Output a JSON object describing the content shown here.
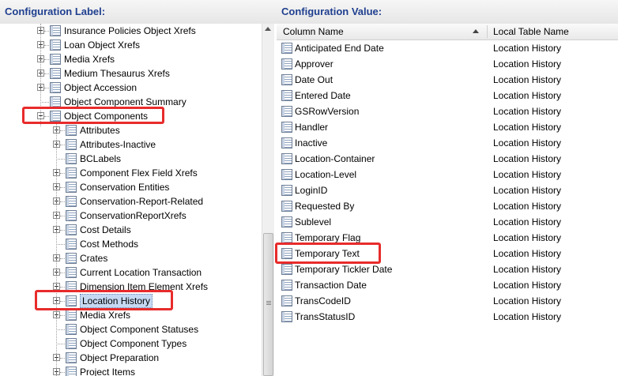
{
  "left_panel": {
    "title": "Configuration Label:"
  },
  "right_panel": {
    "title": "Configuration Value:"
  },
  "tree": [
    {
      "label": "Insurance Policies Object Xrefs",
      "level": 1,
      "expander": "plus"
    },
    {
      "label": "Loan Object Xrefs",
      "level": 1,
      "expander": "plus"
    },
    {
      "label": "Media Xrefs",
      "level": 1,
      "expander": "plus"
    },
    {
      "label": "Medium Thesaurus Xrefs",
      "level": 1,
      "expander": "plus"
    },
    {
      "label": "Object Accession",
      "level": 1,
      "expander": "plus"
    },
    {
      "label": "Object Component Summary",
      "level": 1,
      "expander": "none"
    },
    {
      "label": "Object Components",
      "level": 1,
      "expander": "minus"
    },
    {
      "label": "Attributes",
      "level": 2,
      "expander": "plus"
    },
    {
      "label": "Attributes-Inactive",
      "level": 2,
      "expander": "plus"
    },
    {
      "label": "BCLabels",
      "level": 2,
      "expander": "none"
    },
    {
      "label": "Component Flex Field Xrefs",
      "level": 2,
      "expander": "plus"
    },
    {
      "label": "Conservation Entities",
      "level": 2,
      "expander": "plus"
    },
    {
      "label": "Conservation-Report-Related",
      "level": 2,
      "expander": "plus"
    },
    {
      "label": "ConservationReportXrefs",
      "level": 2,
      "expander": "plus"
    },
    {
      "label": "Cost Details",
      "level": 2,
      "expander": "plus"
    },
    {
      "label": "Cost Methods",
      "level": 2,
      "expander": "none"
    },
    {
      "label": "Crates",
      "level": 2,
      "expander": "plus"
    },
    {
      "label": "Current Location Transaction",
      "level": 2,
      "expander": "plus"
    },
    {
      "label": "Dimension Item Element Xrefs",
      "level": 2,
      "expander": "plus"
    },
    {
      "label": "Location History",
      "level": 2,
      "expander": "plus",
      "selected": true
    },
    {
      "label": "Media Xrefs",
      "level": 2,
      "expander": "plus"
    },
    {
      "label": "Object Component Statuses",
      "level": 2,
      "expander": "none"
    },
    {
      "label": "Object Component Types",
      "level": 2,
      "expander": "none"
    },
    {
      "label": "Object Preparation",
      "level": 2,
      "expander": "plus"
    },
    {
      "label": "Project Items",
      "level": 2,
      "expander": "plus"
    }
  ],
  "grid": {
    "columns": [
      "Column Name",
      "Local Table Name"
    ],
    "rows": [
      [
        "Anticipated End Date",
        "Location History"
      ],
      [
        "Approver",
        "Location History"
      ],
      [
        "Date Out",
        "Location History"
      ],
      [
        "Entered Date",
        "Location History"
      ],
      [
        "GSRowVersion",
        "Location History"
      ],
      [
        "Handler",
        "Location History"
      ],
      [
        "Inactive",
        "Location History"
      ],
      [
        "Location-Container",
        "Location History"
      ],
      [
        "Location-Level",
        "Location History"
      ],
      [
        "LoginID",
        "Location History"
      ],
      [
        "Requested By",
        "Location History"
      ],
      [
        "Sublevel",
        "Location History"
      ],
      [
        "Temporary Flag",
        "Location History"
      ],
      [
        "Temporary Text",
        "Location History"
      ],
      [
        "Temporary Tickler Date",
        "Location History"
      ],
      [
        "Transaction Date",
        "Location History"
      ],
      [
        "TransCodeID",
        "Location History"
      ],
      [
        "TransStatusID",
        "Location History"
      ]
    ]
  },
  "colors": {
    "highlight": "#e82b2b",
    "header_text": "#1f3f8f",
    "selection": "#c6d9f3"
  }
}
